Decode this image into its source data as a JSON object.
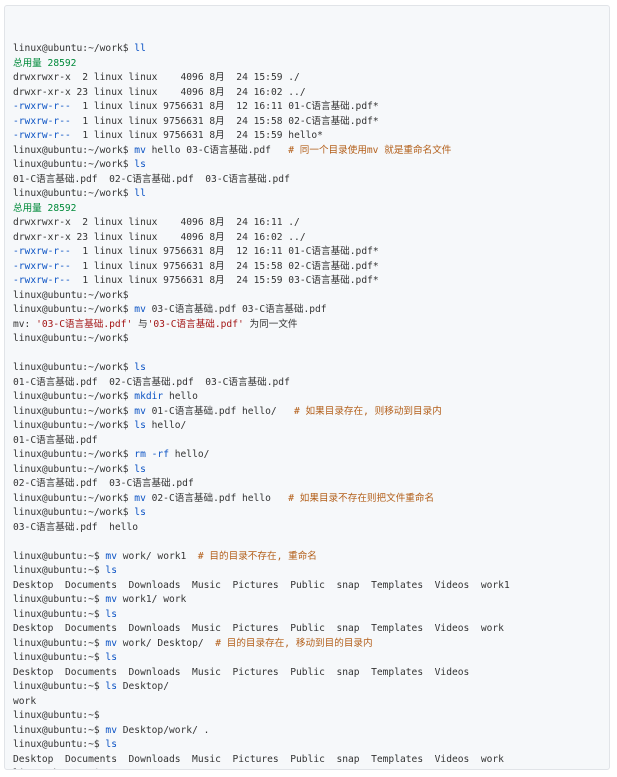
{
  "terminal": {
    "lines": [
      [
        {
          "t": "linux@ubuntu:~/work$ "
        },
        {
          "t": "ll",
          "c": "cmd"
        }
      ],
      [
        {
          "t": "总用量 28592",
          "c": "green"
        }
      ],
      [
        {
          "t": "drwxrwxr-x  2 linux linux    4096 8月  24 15:59 ./"
        }
      ],
      [
        {
          "t": "drwxr-xr-x 23 linux linux    4096 8月  24 16:02 ../"
        }
      ],
      [
        {
          "t": "-rwxrw-r--",
          "c": "cmd"
        },
        {
          "t": "  1 linux linux 9756631 8月  12 16:11 01-C语言基础.pdf*"
        }
      ],
      [
        {
          "t": "-rwxrw-r--",
          "c": "cmd"
        },
        {
          "t": "  1 linux linux 9756631 8月  24 15:58 02-C语言基础.pdf*"
        }
      ],
      [
        {
          "t": "-rwxrw-r--",
          "c": "cmd"
        },
        {
          "t": "  1 linux linux 9756631 8月  24 15:59 hello*"
        }
      ],
      [
        {
          "t": "linux@ubuntu:~/work$ "
        },
        {
          "t": "mv",
          "c": "cmd"
        },
        {
          "t": " hello 03-C语言基础.pdf   "
        },
        {
          "t": "# 同一个目录使用mv 就是重命名文件",
          "c": "comment"
        }
      ],
      [
        {
          "t": "linux@ubuntu:~/work$ "
        },
        {
          "t": "ls",
          "c": "cmd"
        }
      ],
      [
        {
          "t": "01-C语言基础.pdf  02-C语言基础.pdf  03-C语言基础.pdf"
        }
      ],
      [
        {
          "t": "linux@ubuntu:~/work$ "
        },
        {
          "t": "ll",
          "c": "cmd"
        }
      ],
      [
        {
          "t": "总用量 28592",
          "c": "green"
        }
      ],
      [
        {
          "t": "drwxrwxr-x  2 linux linux    4096 8月  24 16:11 ./"
        }
      ],
      [
        {
          "t": "drwxr-xr-x 23 linux linux    4096 8月  24 16:02 ../"
        }
      ],
      [
        {
          "t": "-rwxrw-r--",
          "c": "cmd"
        },
        {
          "t": "  1 linux linux 9756631 8月  12 16:11 01-C语言基础.pdf*"
        }
      ],
      [
        {
          "t": "-rwxrw-r--",
          "c": "cmd"
        },
        {
          "t": "  1 linux linux 9756631 8月  24 15:58 02-C语言基础.pdf*"
        }
      ],
      [
        {
          "t": "-rwxrw-r--",
          "c": "cmd"
        },
        {
          "t": "  1 linux linux 9756631 8月  24 15:59 03-C语言基础.pdf*"
        }
      ],
      [
        {
          "t": "linux@ubuntu:~/work$"
        }
      ],
      [
        {
          "t": "linux@ubuntu:~/work$ "
        },
        {
          "t": "mv",
          "c": "cmd"
        },
        {
          "t": " 03-C语言基础.pdf 03-C语言基础.pdf"
        }
      ],
      [
        {
          "t": "mv: "
        },
        {
          "t": "'03-C语言基础.pdf'",
          "c": "str"
        },
        {
          "t": " 与"
        },
        {
          "t": "'03-C语言基础.pdf'",
          "c": "str"
        },
        {
          "t": " 为同一文件"
        }
      ],
      [
        {
          "t": "linux@ubuntu:~/work$"
        }
      ],
      [
        {
          "t": ""
        }
      ],
      [
        {
          "t": "linux@ubuntu:~/work$ "
        },
        {
          "t": "ls",
          "c": "cmd"
        }
      ],
      [
        {
          "t": "01-C语言基础.pdf  02-C语言基础.pdf  03-C语言基础.pdf"
        }
      ],
      [
        {
          "t": "linux@ubuntu:~/work$ "
        },
        {
          "t": "mkdir",
          "c": "cmd"
        },
        {
          "t": " hello"
        }
      ],
      [
        {
          "t": "linux@ubuntu:~/work$ "
        },
        {
          "t": "mv",
          "c": "cmd"
        },
        {
          "t": " 01-C语言基础.pdf hello/   "
        },
        {
          "t": "# 如果目录存在, 则移动到目录内",
          "c": "comment"
        }
      ],
      [
        {
          "t": "linux@ubuntu:~/work$ "
        },
        {
          "t": "ls",
          "c": "cmd"
        },
        {
          "t": " hello/"
        }
      ],
      [
        {
          "t": "01-C语言基础.pdf"
        }
      ],
      [
        {
          "t": "linux@ubuntu:~/work$ "
        },
        {
          "t": "rm",
          "c": "cmd"
        },
        {
          "t": " "
        },
        {
          "t": "-rf",
          "c": "cmd"
        },
        {
          "t": " hello/"
        }
      ],
      [
        {
          "t": "linux@ubuntu:~/work$ "
        },
        {
          "t": "ls",
          "c": "cmd"
        }
      ],
      [
        {
          "t": "02-C语言基础.pdf  03-C语言基础.pdf"
        }
      ],
      [
        {
          "t": "linux@ubuntu:~/work$ "
        },
        {
          "t": "mv",
          "c": "cmd"
        },
        {
          "t": " 02-C语言基础.pdf hello   "
        },
        {
          "t": "# 如果目录不存在则把文件重命名",
          "c": "comment"
        }
      ],
      [
        {
          "t": "linux@ubuntu:~/work$ "
        },
        {
          "t": "ls",
          "c": "cmd"
        }
      ],
      [
        {
          "t": "03-C语言基础.pdf  hello"
        }
      ],
      [
        {
          "t": ""
        }
      ],
      [
        {
          "t": "linux@ubuntu:~$ "
        },
        {
          "t": "mv",
          "c": "cmd"
        },
        {
          "t": " work/ work1  "
        },
        {
          "t": "# 目的目录不存在, 重命名",
          "c": "comment"
        }
      ],
      [
        {
          "t": "linux@ubuntu:~$ "
        },
        {
          "t": "ls",
          "c": "cmd"
        }
      ],
      [
        {
          "t": "Desktop  Documents  Downloads  Music  Pictures  Public  snap  Templates  Videos  work1"
        }
      ],
      [
        {
          "t": "linux@ubuntu:~$ "
        },
        {
          "t": "mv",
          "c": "cmd"
        },
        {
          "t": " work1/ work"
        }
      ],
      [
        {
          "t": "linux@ubuntu:~$ "
        },
        {
          "t": "ls",
          "c": "cmd"
        }
      ],
      [
        {
          "t": "Desktop  Documents  Downloads  Music  Pictures  Public  snap  Templates  Videos  work"
        }
      ],
      [
        {
          "t": "linux@ubuntu:~$ "
        },
        {
          "t": "mv",
          "c": "cmd"
        },
        {
          "t": " work/ Desktop/  "
        },
        {
          "t": "# 目的目录存在, 移动到目的目录内",
          "c": "comment"
        }
      ],
      [
        {
          "t": "linux@ubuntu:~$ "
        },
        {
          "t": "ls",
          "c": "cmd"
        }
      ],
      [
        {
          "t": "Desktop  Documents  Downloads  Music  Pictures  Public  snap  Templates  Videos"
        }
      ],
      [
        {
          "t": "linux@ubuntu:~$ "
        },
        {
          "t": "ls",
          "c": "cmd"
        },
        {
          "t": " Desktop/"
        }
      ],
      [
        {
          "t": "work"
        }
      ],
      [
        {
          "t": "linux@ubuntu:~$"
        }
      ],
      [
        {
          "t": "linux@ubuntu:~$ "
        },
        {
          "t": "mv",
          "c": "cmd"
        },
        {
          "t": " Desktop/work/ ."
        }
      ],
      [
        {
          "t": "linux@ubuntu:~$ "
        },
        {
          "t": "ls",
          "c": "cmd"
        }
      ],
      [
        {
          "t": "Desktop  Documents  Downloads  Music  Pictures  Public  snap  Templates  Videos  work"
        }
      ],
      [
        {
          "t": "linux@ubuntu:~$"
        }
      ]
    ]
  },
  "colors": {
    "command": "#0a52c4",
    "summary": "#008a3a",
    "comment": "#b35f1a",
    "string": "#a31515"
  }
}
